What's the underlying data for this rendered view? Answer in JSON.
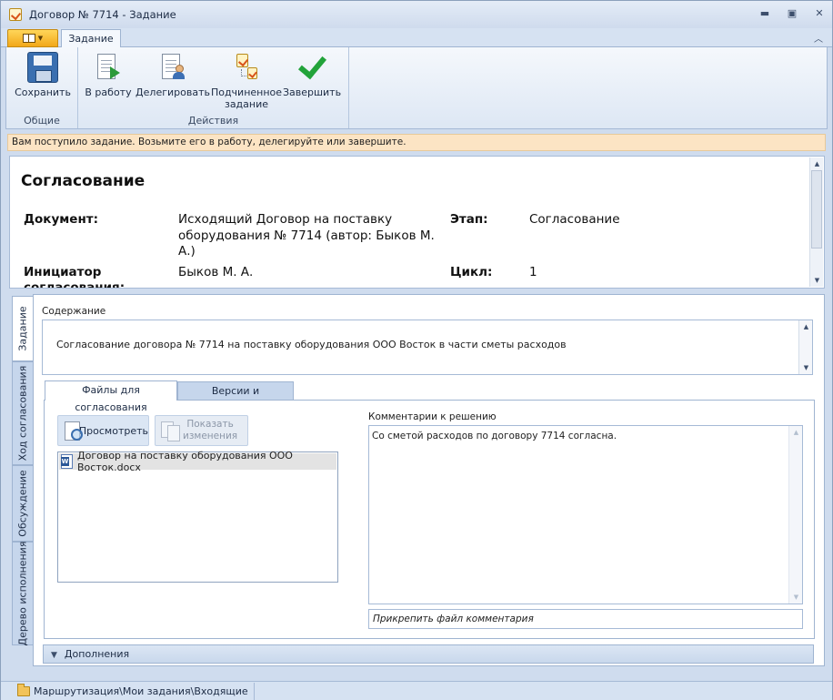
{
  "window": {
    "title": "Договор № 7714 - Задание"
  },
  "ribbon": {
    "tab_label": "Задание",
    "groups": {
      "general_label": "Общие",
      "actions_label": "Действия"
    },
    "buttons": {
      "save": "Сохранить",
      "take": "В работу",
      "delegate": "Делегировать",
      "subtask_line1": "Подчиненное",
      "subtask_line2": "задание",
      "complete": "Завершить"
    }
  },
  "info_bar": {
    "text": "Вам поступило задание. Возьмите его в работу, делегируйте или завершите."
  },
  "header": {
    "title": "Согласование",
    "document_label": "Документ:",
    "document_value": "Исходящий Договор на поставку оборудования № 7714 (автор: Быков М. А.)",
    "stage_label": "Этап:",
    "stage_value": "Согласование",
    "initiator_label": "Инициатор согласования:",
    "initiator_value": "Быков М. А.",
    "cycle_label": "Цикл:",
    "cycle_value": "1"
  },
  "side_tabs": {
    "task": "Задание",
    "approval_progress": "Ход согласования",
    "discussion": "Обсуждение",
    "execution_tree": "Дерево исполнения"
  },
  "content": {
    "label": "Содержание",
    "text": "Согласование договора № 7714 на поставку оборудования ООО Восток в части сметы расходов"
  },
  "inner_tabs": {
    "files": "Файлы для согласования",
    "versions": "Версии и комментарии"
  },
  "files": {
    "view_button": "Просмотреть",
    "changes_button_line1": "Показать",
    "changes_button_line2": "изменения",
    "items": [
      "Договор на поставку оборудования ООО Восток.docx"
    ]
  },
  "comments": {
    "label": "Комментарии к решению",
    "text": "Со сметой расходов по договору 7714 согласна.",
    "attach_placeholder": "Прикрепить файл комментария"
  },
  "extras": {
    "label": "Дополнения"
  },
  "status_bar": {
    "path": "Маршрутизация\\Мои задания\\Входящие"
  },
  "colors": {
    "info_bar_bg": "#fce4c4",
    "app_button": "#f2a819",
    "complete_check": "#22a33a"
  }
}
